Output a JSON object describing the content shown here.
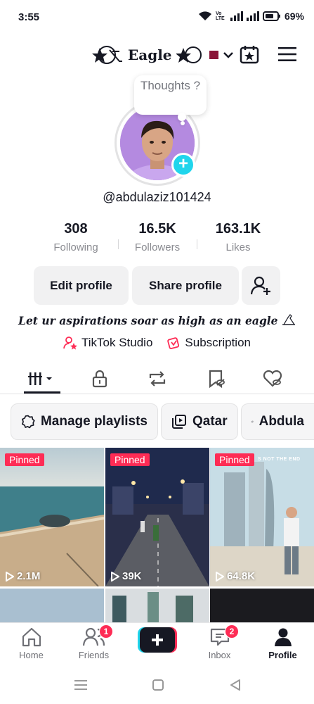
{
  "status_bar": {
    "time": "3:55",
    "network": "Vo LTE",
    "battery": "69%"
  },
  "header": {
    "title": "Eagle"
  },
  "profile": {
    "note_bubble": "Thoughts ?",
    "username": "@abdulaziz101424",
    "stats": [
      {
        "value": "308",
        "label": "Following"
      },
      {
        "value": "16.5K",
        "label": "Followers"
      },
      {
        "value": "163.1K",
        "label": "Likes"
      }
    ],
    "buttons": {
      "edit": "Edit profile",
      "share": "Share profile"
    },
    "bio": "Let ur aspirations soar as high as an eagle",
    "links": {
      "studio": "TikTok Studio",
      "subscription": "Subscription"
    }
  },
  "playlists": [
    "Manage playlists",
    "Qatar",
    "Abdula"
  ],
  "videos": [
    {
      "pinned": "Pinned",
      "views": "2.1M"
    },
    {
      "pinned": "Pinned",
      "views": "39K"
    },
    {
      "pinned": "Pinned",
      "views": "64.8K",
      "overlay_text": "S NOT THE END"
    }
  ],
  "nav": {
    "home": "Home",
    "friends": "Friends",
    "friends_badge": "1",
    "inbox": "Inbox",
    "inbox_badge": "2",
    "profile": "Profile"
  },
  "colors": {
    "accent": "#fe2c55",
    "cyan": "#20d5ec"
  }
}
